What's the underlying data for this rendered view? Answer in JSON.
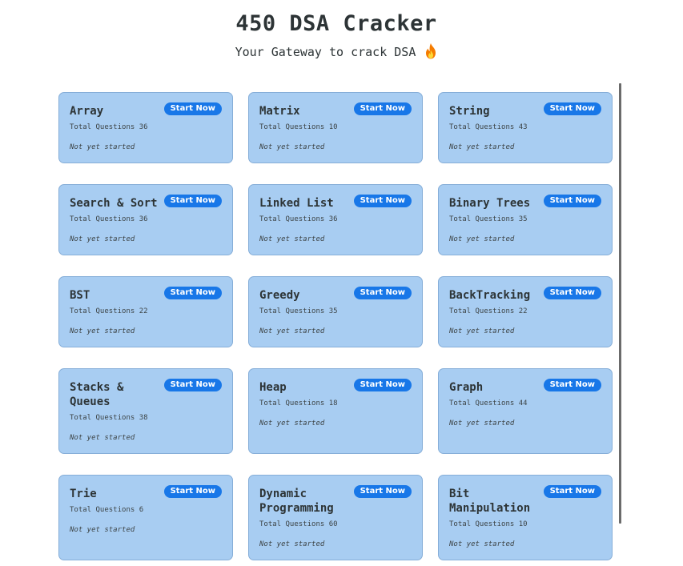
{
  "header": {
    "title": "450 DSA Cracker",
    "subtitle": "Your Gateway to crack DSA"
  },
  "topics": [
    {
      "name": "Array",
      "total": "Total Questions 36",
      "status": "Not yet started",
      "button": "Start Now"
    },
    {
      "name": "Matrix",
      "total": "Total Questions 10",
      "status": "Not yet started",
      "button": "Start Now"
    },
    {
      "name": "String",
      "total": "Total Questions 43",
      "status": "Not yet started",
      "button": "Start Now"
    },
    {
      "name": "Search & Sort",
      "total": "Total Questions 36",
      "status": "Not yet started",
      "button": "Start Now"
    },
    {
      "name": "Linked List",
      "total": "Total Questions 36",
      "status": "Not yet started",
      "button": "Start Now"
    },
    {
      "name": "Binary Trees",
      "total": "Total Questions 35",
      "status": "Not yet started",
      "button": "Start Now"
    },
    {
      "name": "BST",
      "total": "Total Questions 22",
      "status": "Not yet started",
      "button": "Start Now"
    },
    {
      "name": "Greedy",
      "total": "Total Questions 35",
      "status": "Not yet started",
      "button": "Start Now"
    },
    {
      "name": "BackTracking",
      "total": "Total Questions 22",
      "status": "Not yet started",
      "button": "Start Now"
    },
    {
      "name": "Stacks & Queues",
      "total": "Total Questions 38",
      "status": "Not yet started",
      "button": "Start Now"
    },
    {
      "name": "Heap",
      "total": "Total Questions 18",
      "status": "Not yet started",
      "button": "Start Now"
    },
    {
      "name": "Graph",
      "total": "Total Questions 44",
      "status": "Not yet started",
      "button": "Start Now"
    },
    {
      "name": "Trie",
      "total": "Total Questions 6",
      "status": "Not yet started",
      "button": "Start Now"
    },
    {
      "name": "Dynamic Programming",
      "total": "Total Questions 60",
      "status": "Not yet started",
      "button": "Start Now"
    },
    {
      "name": "Bit Manipulation",
      "total": "Total Questions 10",
      "status": "Not yet started",
      "button": "Start Now"
    }
  ],
  "colors": {
    "card_bg": "#a8cdf2",
    "card_border": "#86aed8",
    "button_bg": "#1877e8",
    "text": "#2d3436"
  },
  "icons": {
    "subtitle_icon": "fire-icon"
  }
}
